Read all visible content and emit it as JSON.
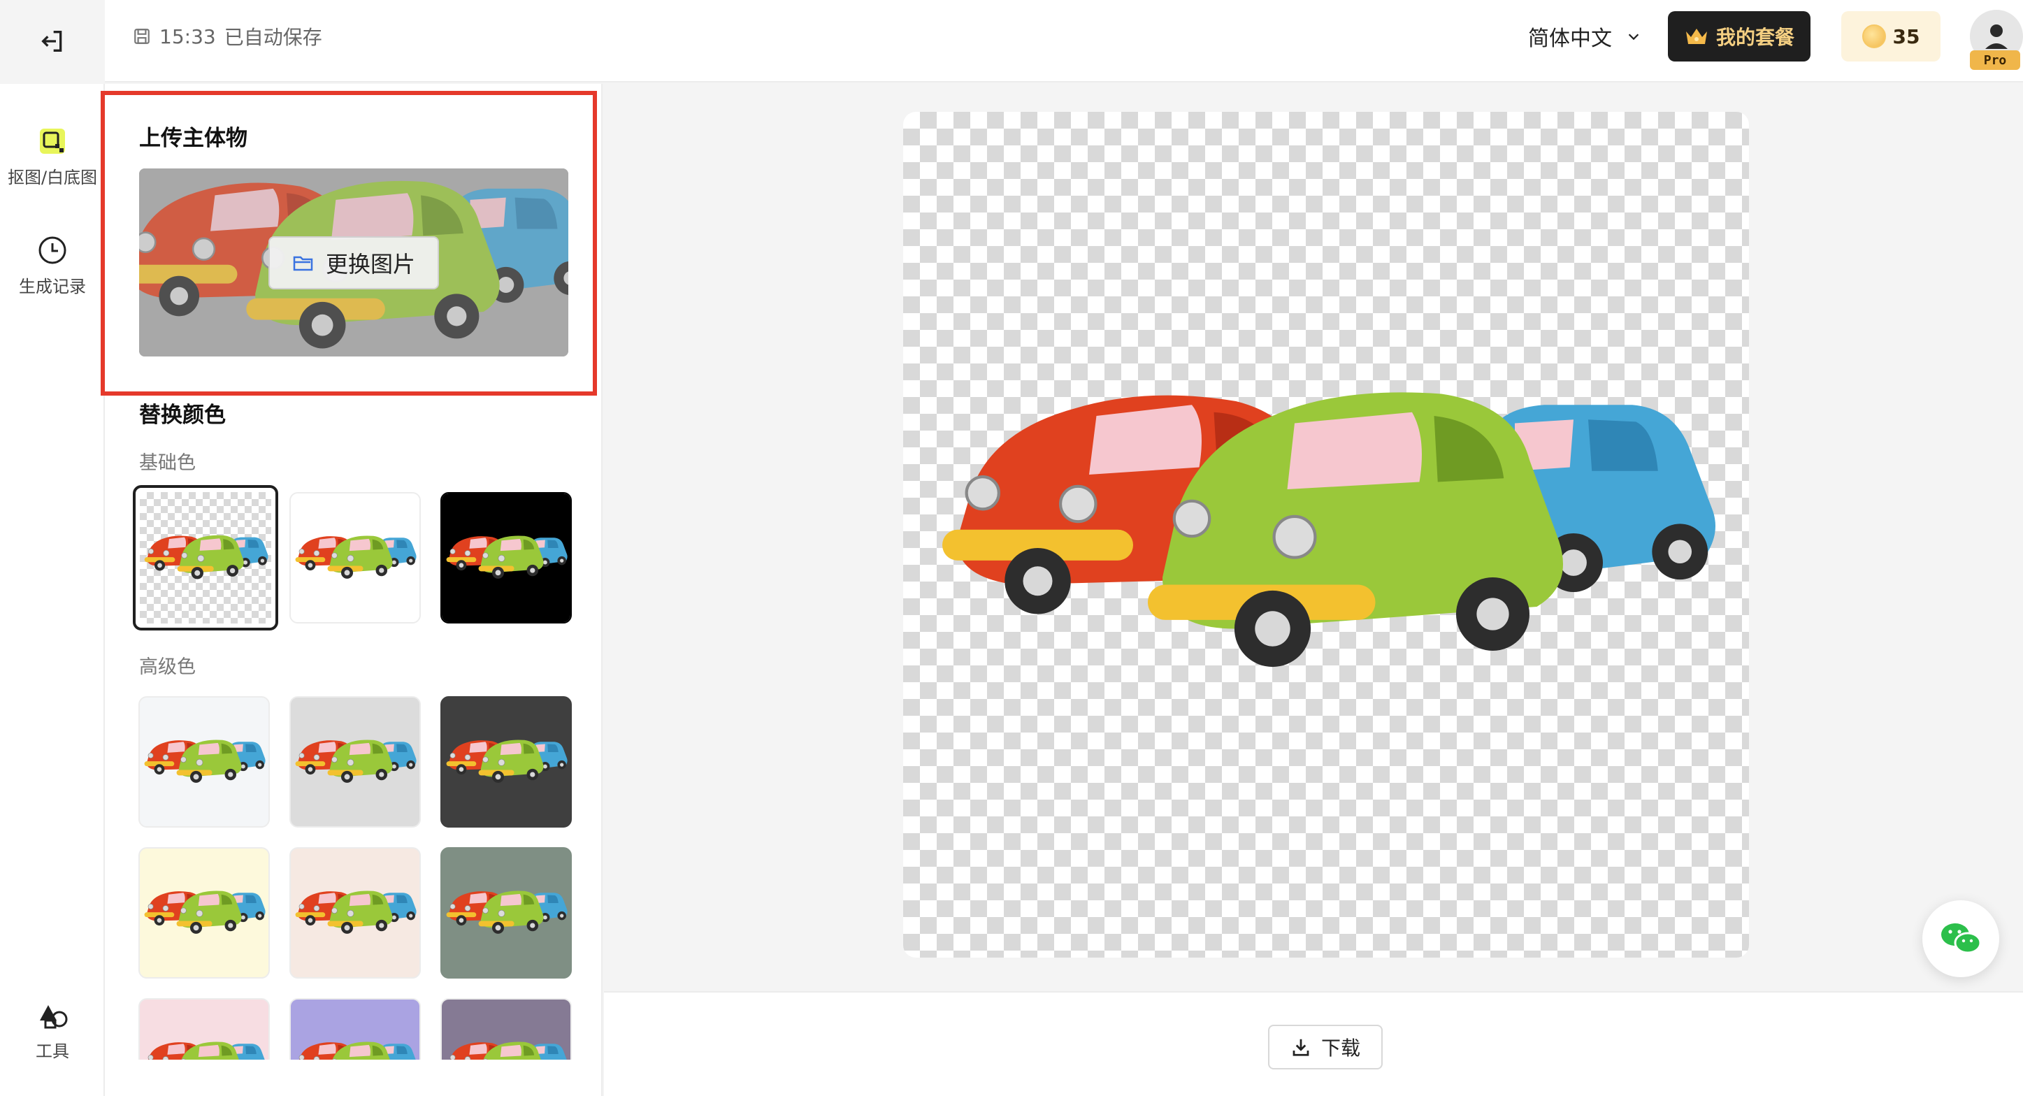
{
  "header": {
    "autosave_time": "15:33",
    "autosave_text": "已自动保存",
    "language": "简体中文",
    "plan_label": "我的套餐",
    "coins": "35",
    "pro_badge": "Pro"
  },
  "rail": {
    "items": [
      {
        "label": "抠图/白底图",
        "icon": "cutout-icon",
        "active": true
      },
      {
        "label": "生成记录",
        "icon": "clock-icon",
        "active": false
      },
      {
        "label": "工具",
        "icon": "tools-icon",
        "active": false
      }
    ]
  },
  "panel": {
    "upload_title": "上传主体物",
    "replace_label": "更换图片",
    "color_title": "替换颜色",
    "basic_label": "基础色",
    "advanced_label": "高级色",
    "basic_colors": [
      "transparent",
      "#ffffff",
      "#000000"
    ],
    "advanced_colors": [
      "#f4f6f8",
      "#dcdcdc",
      "#3f3f3f",
      "#fdf9dc",
      "#f6e9e2",
      "#7f8f84",
      "#f7dde2",
      "#aaa3e2",
      "#857a94"
    ]
  },
  "canvas": {
    "download_label": "下载"
  },
  "colors": {
    "accent_highlight": "#e5392b",
    "car_red": "#e0411f",
    "car_green": "#9ac83a",
    "car_blue": "#45a6d6",
    "bumper_yellow": "#f3c12f"
  }
}
